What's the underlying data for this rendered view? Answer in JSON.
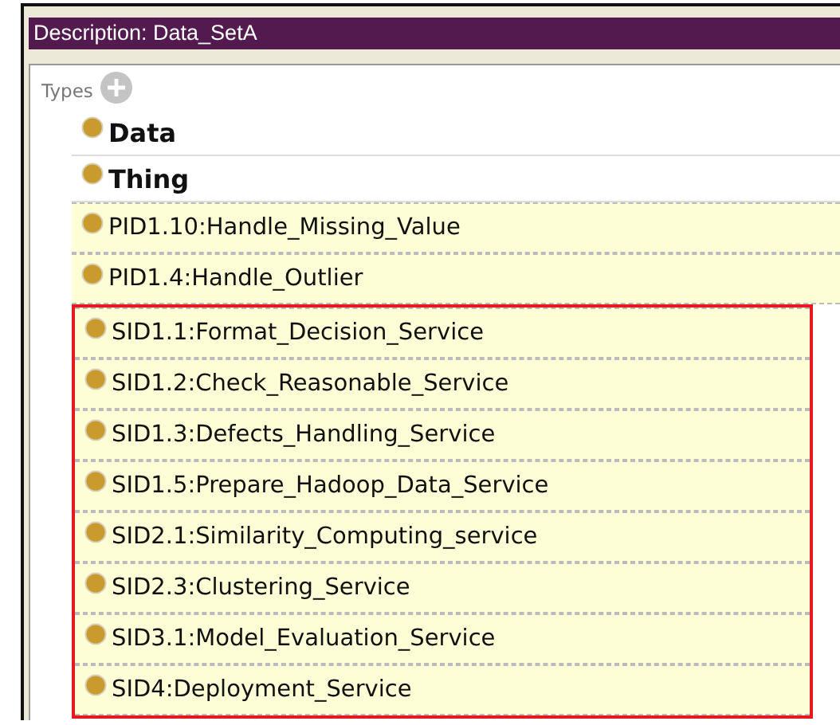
{
  "panel": {
    "title": "Description: Data_SetA"
  },
  "types": {
    "label": "Types",
    "items": [
      {
        "label": "Data",
        "kind": "asserted"
      },
      {
        "label": "Thing",
        "kind": "asserted"
      },
      {
        "label": "PID1.10:Handle_Missing_Value",
        "kind": "inferred"
      },
      {
        "label": "PID1.4:Handle_Outlier",
        "kind": "inferred"
      }
    ],
    "highlight_box": {
      "items": [
        {
          "label": "SID1.1:Format_Decision_Service",
          "kind": "inferred"
        },
        {
          "label": "SID1.2:Check_Reasonable_Service",
          "kind": "inferred"
        },
        {
          "label": "SID1.3:Defects_Handling_Service",
          "kind": "inferred"
        },
        {
          "label": "SID1.5:Prepare_Hadoop_Data_Service",
          "kind": "inferred"
        },
        {
          "label": "SID2.1:Similarity_Computing_service",
          "kind": "inferred"
        },
        {
          "label": "SID2.3:Clustering_Service",
          "kind": "inferred"
        },
        {
          "label": "SID3.1:Model_Evaluation_Service",
          "kind": "inferred"
        },
        {
          "label": "SID4:Deployment_Service",
          "kind": "inferred"
        }
      ]
    }
  }
}
